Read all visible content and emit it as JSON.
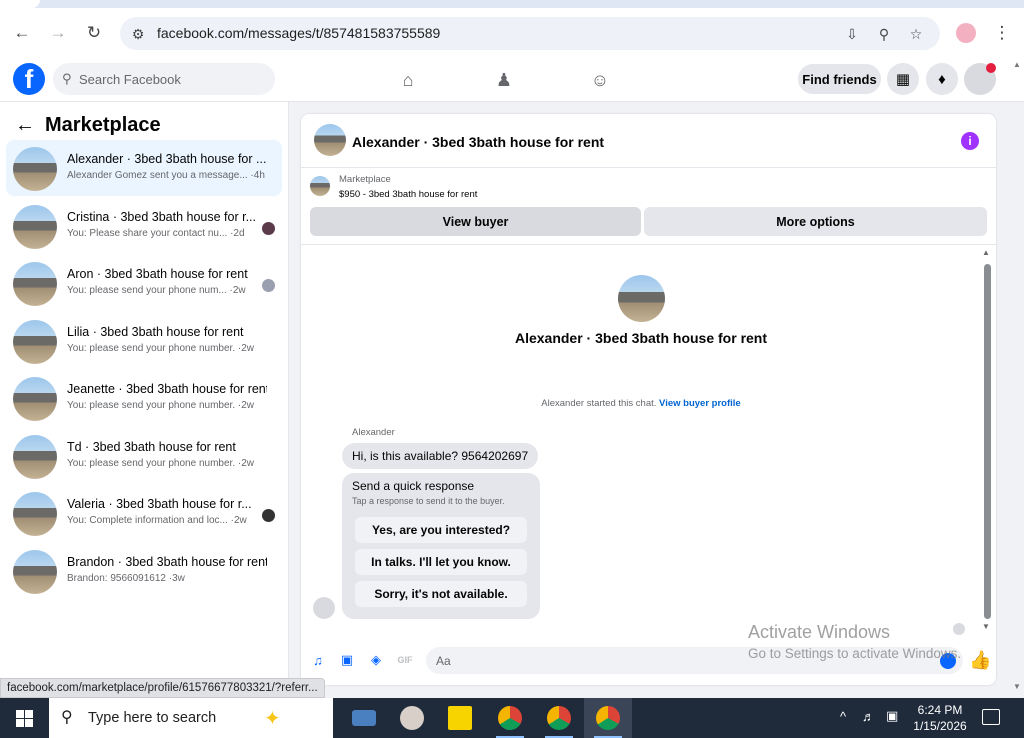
{
  "browser": {
    "url": "facebook.com/messages/t/857481583755589",
    "status_link": "facebook.com/marketplace/profile/61576677803321/?referr..."
  },
  "fb_header": {
    "search_placeholder": "Search Facebook",
    "find_friends": "Find friends"
  },
  "sidebar": {
    "title": "Marketplace",
    "conversations": [
      {
        "title": "Alexander · 3bed 3bath house for ...",
        "snippet": "Alexander Gomez sent you a message... ·4h",
        "selected": true
      },
      {
        "title": "Cristina · 3bed 3bath house for r...",
        "snippet": "You: Please share your contact nu... ·2d"
      },
      {
        "title": "Aron · 3bed 3bath house for rent",
        "snippet": "You: please send your phone num... ·2w"
      },
      {
        "title": "Lilia · 3bed 3bath house for rent",
        "snippet": "You: please send your phone number. ·2w"
      },
      {
        "title": "Jeanette · 3bed 3bath house for rent",
        "snippet": "You: please send your phone number. ·2w"
      },
      {
        "title": "Td · 3bed 3bath house for rent",
        "snippet": "You: please send your phone number. ·2w"
      },
      {
        "title": "Valeria · 3bed 3bath house for r...",
        "snippet": "You: Complete information and loc... ·2w"
      },
      {
        "title": "Brandon · 3bed 3bath house for rent",
        "snippet": "Brandon: 9566091612 ·3w"
      }
    ]
  },
  "chat": {
    "header_title": "Alexander · 3bed 3bath house for rent",
    "marketplace_label": "Marketplace",
    "listing": "$950 - 3bed 3bath house for rent",
    "view_buyer": "View buyer",
    "more_options": "More options",
    "center_title": "Alexander · 3bed 3bath house for rent",
    "started_text": "Alexander started this chat.",
    "view_buyer_profile": "View buyer profile",
    "sender_name": "Alexander",
    "message": "Hi, is this available? 9564202697",
    "quick_title": "Send a quick response",
    "quick_sub": "Tap a response to send it to the buyer.",
    "quick_responses": [
      "Yes, are you interested?",
      "In talks. I'll let you know.",
      "Sorry, it's not available."
    ],
    "composer_placeholder": "Aa"
  },
  "watermark": {
    "line1": "Activate Windows",
    "line2": "Go to Settings to activate Windows."
  },
  "taskbar": {
    "search_placeholder": "Type here to search",
    "time": "6:24 PM",
    "date": "1/15/2026"
  }
}
